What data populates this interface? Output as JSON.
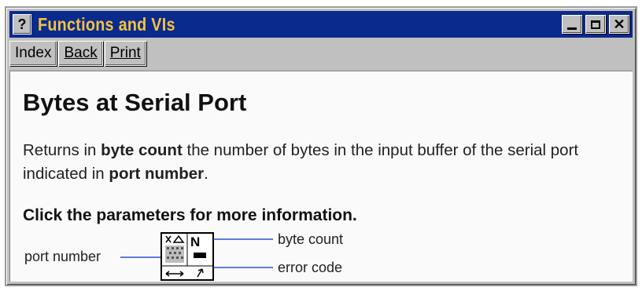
{
  "window": {
    "title": "Functions and VIs",
    "help_glyph": "?",
    "close_glyph": "✕"
  },
  "toolbar": {
    "index_label": "Index",
    "back_label": "Back",
    "print_label": "Print"
  },
  "content": {
    "heading": "Bytes at Serial Port",
    "desc_part1": "Returns in ",
    "desc_bold1": "byte count",
    "desc_part2": " the number of bytes in the input buffer of the serial port indicated in ",
    "desc_bold2": "port number",
    "desc_part3": ".",
    "subheading": "Click the parameters for more information."
  },
  "diagram": {
    "input_label": "port number",
    "output_top_label": "byte count",
    "output_bottom_label": "error code",
    "numeric_terminal": "N"
  }
}
